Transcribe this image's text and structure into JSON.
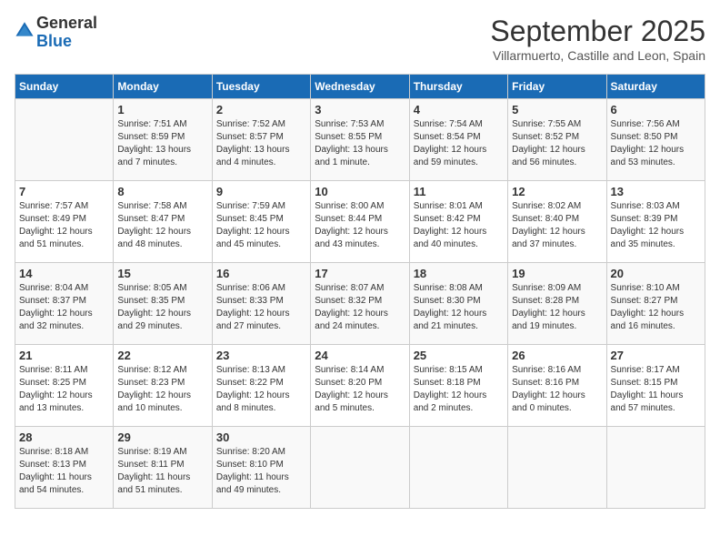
{
  "header": {
    "logo_general": "General",
    "logo_blue": "Blue",
    "month_title": "September 2025",
    "subtitle": "Villarmuerto, Castille and Leon, Spain"
  },
  "weekdays": [
    "Sunday",
    "Monday",
    "Tuesday",
    "Wednesday",
    "Thursday",
    "Friday",
    "Saturday"
  ],
  "weeks": [
    [
      {
        "day": "",
        "info": ""
      },
      {
        "day": "1",
        "info": "Sunrise: 7:51 AM\nSunset: 8:59 PM\nDaylight: 13 hours\nand 7 minutes."
      },
      {
        "day": "2",
        "info": "Sunrise: 7:52 AM\nSunset: 8:57 PM\nDaylight: 13 hours\nand 4 minutes."
      },
      {
        "day": "3",
        "info": "Sunrise: 7:53 AM\nSunset: 8:55 PM\nDaylight: 13 hours\nand 1 minute."
      },
      {
        "day": "4",
        "info": "Sunrise: 7:54 AM\nSunset: 8:54 PM\nDaylight: 12 hours\nand 59 minutes."
      },
      {
        "day": "5",
        "info": "Sunrise: 7:55 AM\nSunset: 8:52 PM\nDaylight: 12 hours\nand 56 minutes."
      },
      {
        "day": "6",
        "info": "Sunrise: 7:56 AM\nSunset: 8:50 PM\nDaylight: 12 hours\nand 53 minutes."
      }
    ],
    [
      {
        "day": "7",
        "info": "Sunrise: 7:57 AM\nSunset: 8:49 PM\nDaylight: 12 hours\nand 51 minutes."
      },
      {
        "day": "8",
        "info": "Sunrise: 7:58 AM\nSunset: 8:47 PM\nDaylight: 12 hours\nand 48 minutes."
      },
      {
        "day": "9",
        "info": "Sunrise: 7:59 AM\nSunset: 8:45 PM\nDaylight: 12 hours\nand 45 minutes."
      },
      {
        "day": "10",
        "info": "Sunrise: 8:00 AM\nSunset: 8:44 PM\nDaylight: 12 hours\nand 43 minutes."
      },
      {
        "day": "11",
        "info": "Sunrise: 8:01 AM\nSunset: 8:42 PM\nDaylight: 12 hours\nand 40 minutes."
      },
      {
        "day": "12",
        "info": "Sunrise: 8:02 AM\nSunset: 8:40 PM\nDaylight: 12 hours\nand 37 minutes."
      },
      {
        "day": "13",
        "info": "Sunrise: 8:03 AM\nSunset: 8:39 PM\nDaylight: 12 hours\nand 35 minutes."
      }
    ],
    [
      {
        "day": "14",
        "info": "Sunrise: 8:04 AM\nSunset: 8:37 PM\nDaylight: 12 hours\nand 32 minutes."
      },
      {
        "day": "15",
        "info": "Sunrise: 8:05 AM\nSunset: 8:35 PM\nDaylight: 12 hours\nand 29 minutes."
      },
      {
        "day": "16",
        "info": "Sunrise: 8:06 AM\nSunset: 8:33 PM\nDaylight: 12 hours\nand 27 minutes."
      },
      {
        "day": "17",
        "info": "Sunrise: 8:07 AM\nSunset: 8:32 PM\nDaylight: 12 hours\nand 24 minutes."
      },
      {
        "day": "18",
        "info": "Sunrise: 8:08 AM\nSunset: 8:30 PM\nDaylight: 12 hours\nand 21 minutes."
      },
      {
        "day": "19",
        "info": "Sunrise: 8:09 AM\nSunset: 8:28 PM\nDaylight: 12 hours\nand 19 minutes."
      },
      {
        "day": "20",
        "info": "Sunrise: 8:10 AM\nSunset: 8:27 PM\nDaylight: 12 hours\nand 16 minutes."
      }
    ],
    [
      {
        "day": "21",
        "info": "Sunrise: 8:11 AM\nSunset: 8:25 PM\nDaylight: 12 hours\nand 13 minutes."
      },
      {
        "day": "22",
        "info": "Sunrise: 8:12 AM\nSunset: 8:23 PM\nDaylight: 12 hours\nand 10 minutes."
      },
      {
        "day": "23",
        "info": "Sunrise: 8:13 AM\nSunset: 8:22 PM\nDaylight: 12 hours\nand 8 minutes."
      },
      {
        "day": "24",
        "info": "Sunrise: 8:14 AM\nSunset: 8:20 PM\nDaylight: 12 hours\nand 5 minutes."
      },
      {
        "day": "25",
        "info": "Sunrise: 8:15 AM\nSunset: 8:18 PM\nDaylight: 12 hours\nand 2 minutes."
      },
      {
        "day": "26",
        "info": "Sunrise: 8:16 AM\nSunset: 8:16 PM\nDaylight: 12 hours\nand 0 minutes."
      },
      {
        "day": "27",
        "info": "Sunrise: 8:17 AM\nSunset: 8:15 PM\nDaylight: 11 hours\nand 57 minutes."
      }
    ],
    [
      {
        "day": "28",
        "info": "Sunrise: 8:18 AM\nSunset: 8:13 PM\nDaylight: 11 hours\nand 54 minutes."
      },
      {
        "day": "29",
        "info": "Sunrise: 8:19 AM\nSunset: 8:11 PM\nDaylight: 11 hours\nand 51 minutes."
      },
      {
        "day": "30",
        "info": "Sunrise: 8:20 AM\nSunset: 8:10 PM\nDaylight: 11 hours\nand 49 minutes."
      },
      {
        "day": "",
        "info": ""
      },
      {
        "day": "",
        "info": ""
      },
      {
        "day": "",
        "info": ""
      },
      {
        "day": "",
        "info": ""
      }
    ]
  ]
}
